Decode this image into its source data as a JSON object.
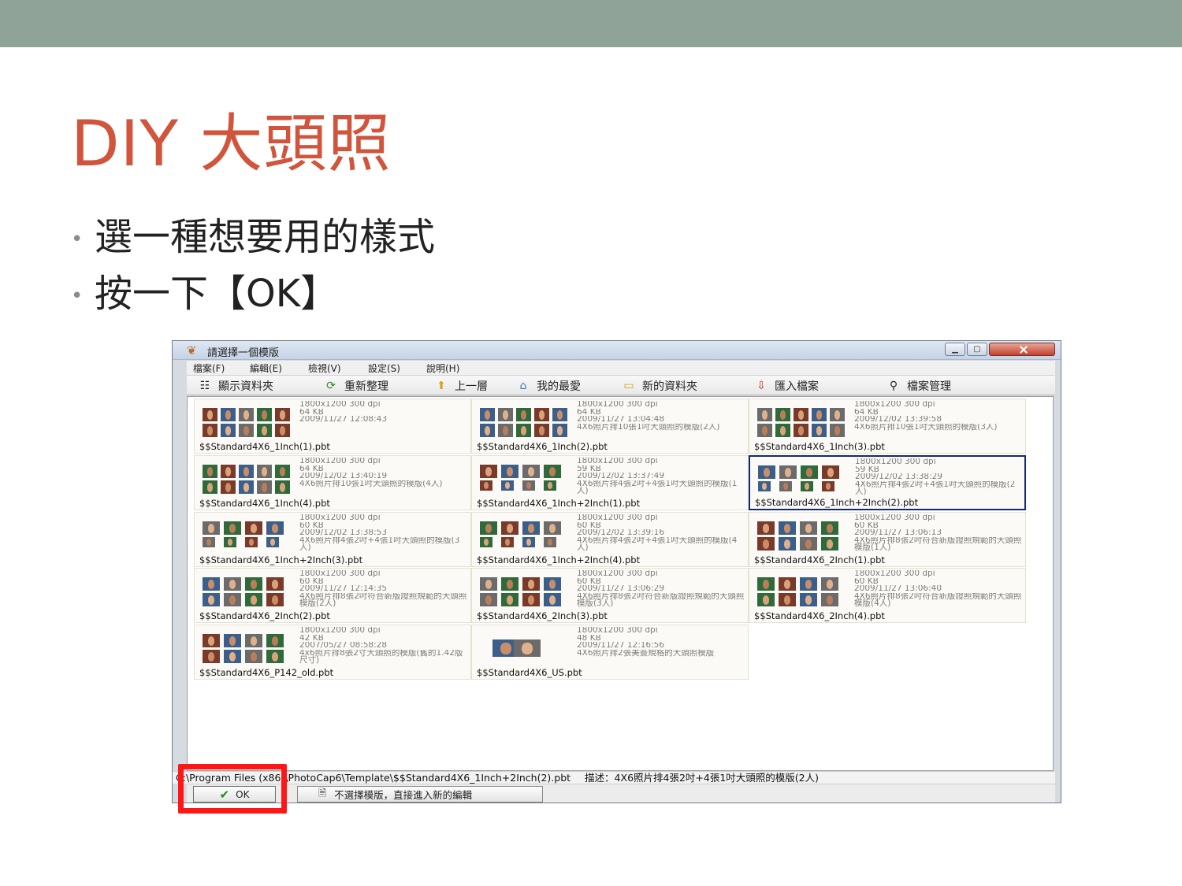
{
  "slide": {
    "title": "DIY 大頭照",
    "bullets": [
      "選一種想要用的樣式",
      "按一下【OK】"
    ]
  },
  "window": {
    "title": "請選擇一個模版",
    "menu": [
      "檔案(F)",
      "編輯(E)",
      "檢視(V)",
      "設定(S)",
      "說明(H)"
    ],
    "toolbar": {
      "show_folder": "顯示資料夾",
      "reorganize": "重新整理",
      "up_level": "上一層",
      "favorites": "我的最愛",
      "new_folder": "新的資料夾",
      "import_file": "匯入檔案",
      "file_manage": "檔案管理"
    },
    "templates": [
      {
        "name": "$$Standard4X6_1Inch(1).pbt",
        "info": "1800x1200 300 dpi",
        "size": "64 KB",
        "date": "2009/11/27 12:08:43",
        "desc": ""
      },
      {
        "name": "$$Standard4X6_1Inch(2).pbt",
        "info": "1800x1200 300 dpi",
        "size": "64 KB",
        "date": "2009/11/27 13:04:48",
        "desc": "4X6照片排10張1吋大頭照的模版(2人)"
      },
      {
        "name": "$$Standard4X6_1Inch(3).pbt",
        "info": "1800x1200 300 dpi",
        "size": "64 KB",
        "date": "2009/12/02 13:39:58",
        "desc": "4X6照片排10張1吋大頭照的模版(3人)"
      },
      {
        "name": "$$Standard4X6_1Inch(4).pbt",
        "info": "1800x1200 300 dpi",
        "size": "64 KB",
        "date": "2009/12/02 13:40:19",
        "desc": "4X6照片排10張1吋大頭照的模版(4人)"
      },
      {
        "name": "$$Standard4X6_1Inch+2Inch(1).pbt",
        "info": "1800x1200 300 dpi",
        "size": "59 KB",
        "date": "2009/12/02 13:37:49",
        "desc": "4X6照片排4張2吋+4張1吋大頭照的模版(1人)"
      },
      {
        "name": "$$Standard4X6_1Inch+2Inch(2).pbt",
        "info": "1800x1200 300 dpi",
        "size": "59 KB",
        "date": "2009/12/02 13:38:29",
        "desc": "4X6照片排4張2吋+4張1吋大頭照的模版(2人)"
      },
      {
        "name": "$$Standard4X6_1Inch+2Inch(3).pbt",
        "info": "1800x1200 300 dpi",
        "size": "60 KB",
        "date": "2009/12/02 13:38:53",
        "desc": "4X6照片排4張2吋+4張1吋大頭照的模版(3人)"
      },
      {
        "name": "$$Standard4X6_1Inch+2Inch(4).pbt",
        "info": "1800x1200 300 dpi",
        "size": "60 KB",
        "date": "2009/12/02 13:39:16",
        "desc": "4X6照片排4張2吋+4張1吋大頭照的模版(4人)"
      },
      {
        "name": "$$Standard4X6_2Inch(1).pbt",
        "info": "1800x1200 300 dpi",
        "size": "60 KB",
        "date": "2009/11/27 13:06:13",
        "desc": "4X6照片排8張2吋符合新版證照規範的大頭照模版(1人)"
      },
      {
        "name": "$$Standard4X6_2Inch(2).pbt",
        "info": "1800x1200 300 dpi",
        "size": "60 KB",
        "date": "2009/11/27 12:14:35",
        "desc": "4X6照片排8張2吋符合新版證照規範的大頭照模版(2人)"
      },
      {
        "name": "$$Standard4X6_2Inch(3).pbt",
        "info": "1800x1200 300 dpi",
        "size": "60 KB",
        "date": "2009/11/27 13:06:29",
        "desc": "4X6照片排8張2吋符合新版證照規範的大頭照模版(3人)"
      },
      {
        "name": "$$Standard4X6_2Inch(4).pbt",
        "info": "1800x1200 300 dpi",
        "size": "60 KB",
        "date": "2009/11/27 13:06:40",
        "desc": "4X6照片排8張2吋符合新版證照規範的大頭照模版(4人)"
      },
      {
        "name": "$$Standard4X6_P142_old.pbt",
        "info": "1800x1200 300 dpi",
        "size": "42 KB",
        "date": "2007/05/27 08:58:28",
        "desc": "4x6照片排8張2寸大頭照的模版(舊的1.42版尺寸)"
      },
      {
        "name": "$$Standard4X6_US.pbt",
        "info": "1800x1200 300 dpi",
        "size": "48 KB",
        "date": "2009/11/27 12:16:56",
        "desc": "4X6照片排2張美簽規格的大頭照模版"
      }
    ],
    "status_path": "C:\\Program Files (x86)\\PhotoCap6\\Template\\$$Standard4X6_1Inch+2Inch(2).pbt",
    "status_desc": "描述：4X6照片排4張2吋+4張1吋大頭照的模版(2人)",
    "ok_label": "OK",
    "skip_label": "不選擇模版，直接進入新的編輯"
  },
  "colors": {
    "header_bar": "#8fa398",
    "title": "#d0553c",
    "selection_border": "#0d2a7a",
    "highlight": "#ff1616"
  }
}
